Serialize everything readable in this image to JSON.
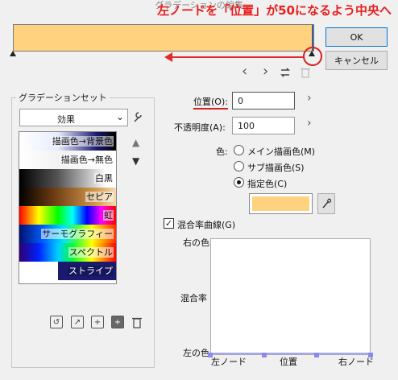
{
  "window": {
    "title": "グラデーションの編集"
  },
  "annotation": "左ノードを「位置」が50になるよう中央へ",
  "gradient_bar": {
    "color": "#ffd27f",
    "handle_color": "#3b5ca8"
  },
  "buttons": {
    "ok": "OK",
    "cancel": "キャンセル"
  },
  "nav": {
    "prev": "‹",
    "next": "›"
  },
  "preset_group": {
    "title": "グラデーションセット",
    "select_value": "効果",
    "items": [
      {
        "label": "描画色→背景色"
      },
      {
        "label": "描画色→無色"
      },
      {
        "label": "白黒"
      },
      {
        "label": "セピア"
      },
      {
        "label": "虹"
      },
      {
        "label": "サーモグラフィー"
      },
      {
        "label": "スペクトル"
      },
      {
        "label": "ストライプ"
      }
    ]
  },
  "position": {
    "label": "位置(O):",
    "value": "0"
  },
  "opacity": {
    "label": "不透明度(A):",
    "value": "100"
  },
  "color": {
    "label": "色:",
    "options": [
      {
        "label": "メイン描画色(M)",
        "checked": false
      },
      {
        "label": "サブ描画色(S)",
        "checked": false
      },
      {
        "label": "指定色(C)",
        "checked": true
      }
    ],
    "swatch": "#ffd27f"
  },
  "blend_curve": {
    "label": "混合率曲線(G)",
    "checked": true,
    "y_top": "右の色",
    "y_mid": "混合率",
    "y_bottom": "左の色",
    "x_left": "左ノード",
    "x_mid": "位置",
    "x_right": "右ノード"
  }
}
